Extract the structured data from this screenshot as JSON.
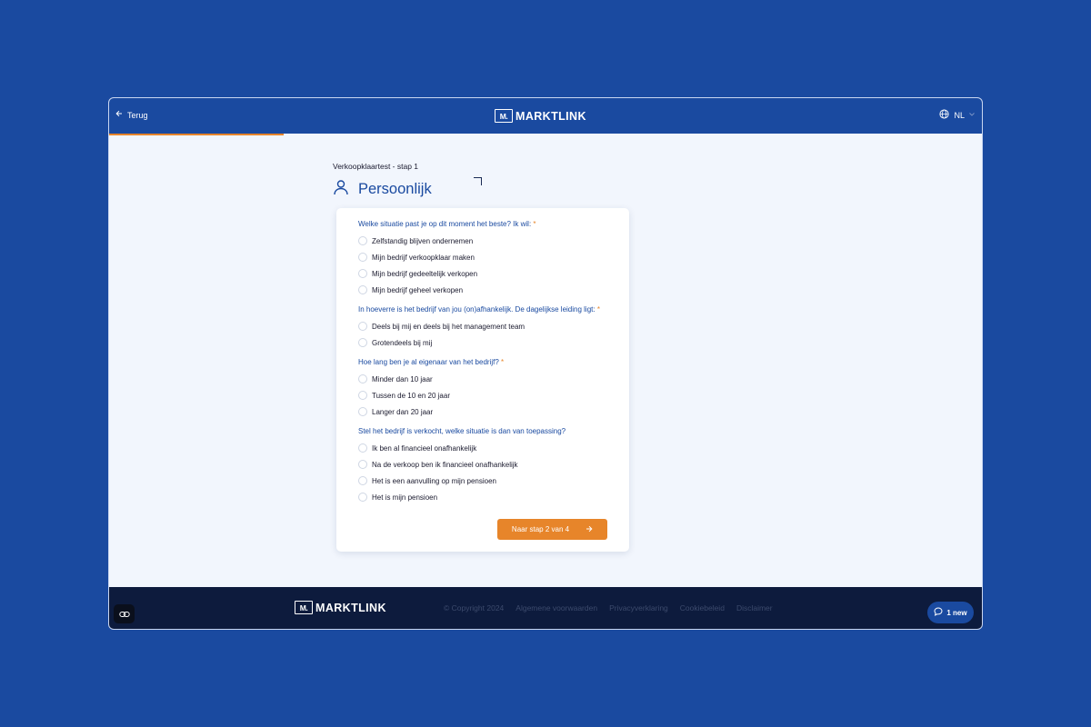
{
  "header": {
    "back_label": "Terug",
    "logo_mark": "M.",
    "logo_text": "MARKTLINK",
    "language": "NL",
    "progress": 0.2
  },
  "main": {
    "step_label": "Verkoopklaartest - stap 1",
    "title": "Persoonlijk",
    "questions": [
      {
        "label": "Welke situatie past je op dit moment het beste? Ik wil:",
        "required": "*",
        "options": [
          "Zelfstandig blijven ondernemen",
          "Mijn bedrijf verkoopklaar maken",
          "Mijn bedrijf gedeeltelijk verkopen",
          "Mijn bedrijf geheel verkopen"
        ]
      },
      {
        "label": "In hoeverre is het bedrijf van jou (on)afhankelijk. De dagelijkse leiding ligt:",
        "required": "*",
        "options": [
          "Deels bij mij en deels bij het management team",
          "Grotendeels bij mij"
        ]
      },
      {
        "label": "Hoe lang ben je al eigenaar van het bedrijf?",
        "required": "*",
        "options": [
          "Minder dan 10 jaar",
          "Tussen de 10 en 20 jaar",
          "Langer dan 20 jaar"
        ]
      },
      {
        "label": "Stel het bedrijf is verkocht, welke situatie is dan van toepassing?",
        "required": "",
        "options": [
          "Ik ben al financieel onafhankelijk",
          "Na de verkoop ben ik financieel onafhankelijk",
          "Het is een aanvulling op mijn pensioen",
          "Het is mijn pensioen"
        ]
      }
    ],
    "submit_label": "Naar stap 2 van 4"
  },
  "footer": {
    "logo_mark": "M.",
    "logo_text": "MARKTLINK",
    "copyright": "© Copyright 2024",
    "links": [
      "Algemene voorwaarden",
      "Privacyverklaring",
      "Cookiebeleid",
      "Disclaimer"
    ],
    "chat_label": "1 new"
  },
  "colors": {
    "brand_blue": "#1a4aa0",
    "accent_orange": "#e7852a",
    "footer_navy": "#0d1b3d"
  }
}
